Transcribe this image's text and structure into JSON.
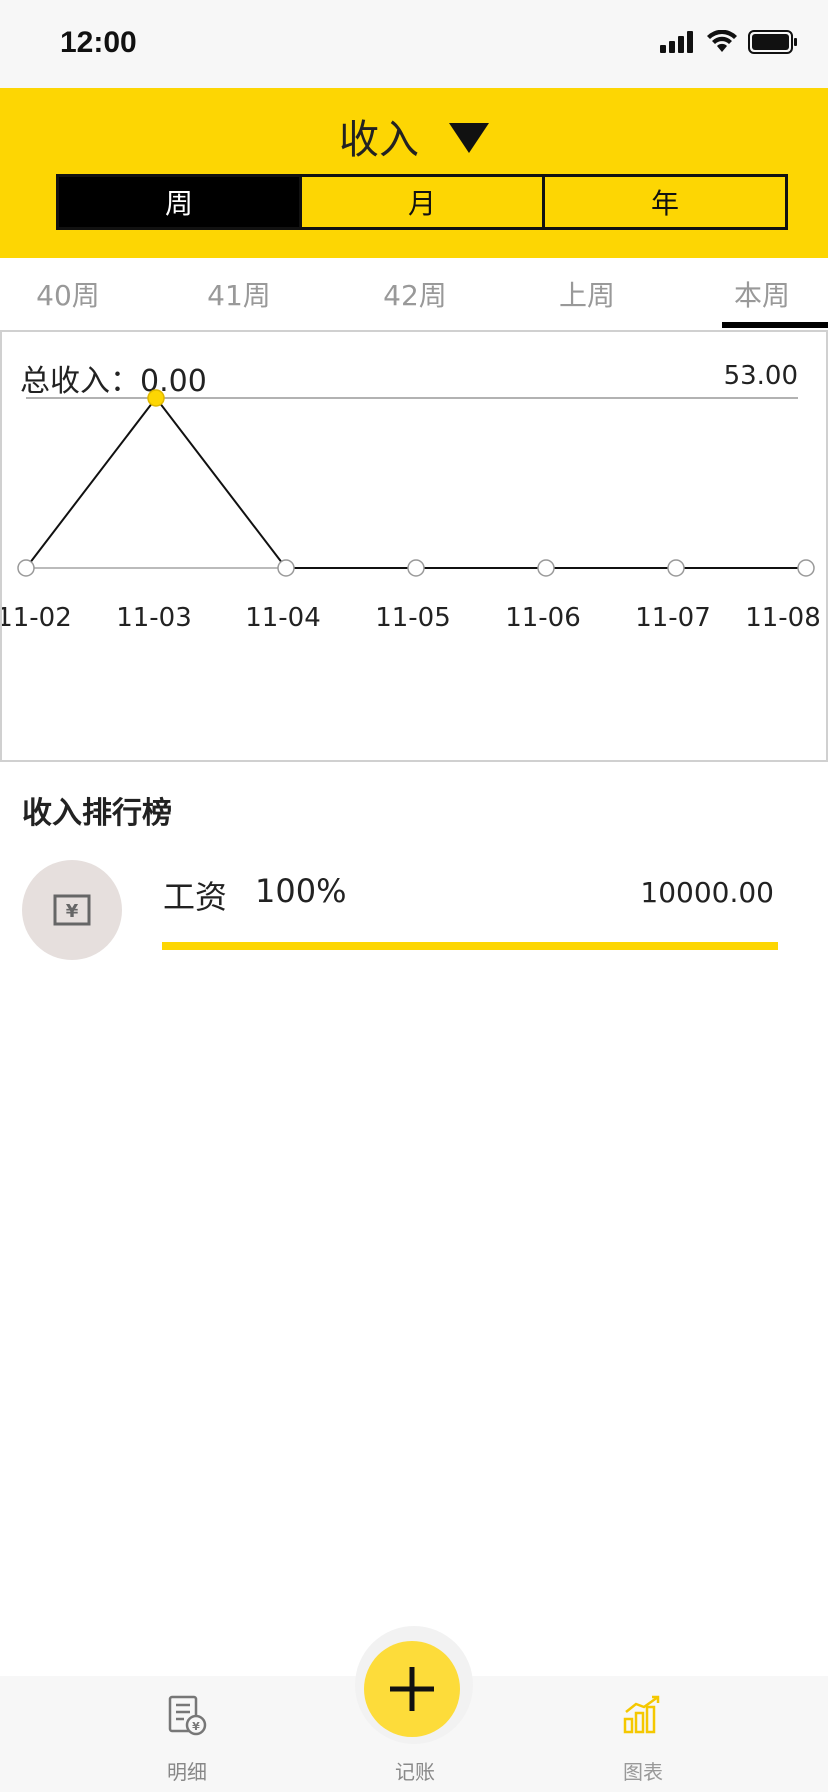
{
  "status_bar": {
    "time": "12:00"
  },
  "header": {
    "title": "收入",
    "segments": [
      {
        "label": "周",
        "active": true
      },
      {
        "label": "月",
        "active": false
      },
      {
        "label": "年",
        "active": false
      }
    ]
  },
  "week_tabs": [
    {
      "label": "40周",
      "active": false
    },
    {
      "label": "41周",
      "active": false
    },
    {
      "label": "42周",
      "active": false
    },
    {
      "label": "上周",
      "active": false
    },
    {
      "label": "本周",
      "active": true
    }
  ],
  "summary": {
    "total_label": "总收入：",
    "total_value": "0.00"
  },
  "chart_data": {
    "type": "line",
    "x": [
      "11-02",
      "11-03",
      "11-04",
      "11-05",
      "11-06",
      "11-07",
      "11-08"
    ],
    "series": [
      {
        "values": [
          0,
          53,
          0,
          0,
          0,
          0,
          0
        ]
      }
    ],
    "max_label": "53.00",
    "ylim": [
      0,
      53
    ],
    "highlight_index": 1,
    "highlight_color": "#fdd603",
    "line_color": "#111111",
    "grid": false
  },
  "ranking": {
    "title": "收入排行榜",
    "items": [
      {
        "icon": "yen-note-icon",
        "name": "工资",
        "percent": "100%",
        "amount": "10000.00",
        "ratio": 1.0
      }
    ]
  },
  "tabbar": {
    "items": [
      {
        "label": "明细",
        "icon": "bill-detail-icon",
        "active": false
      },
      {
        "label": "记账",
        "icon": "plus-icon",
        "active": false
      },
      {
        "label": "图表",
        "icon": "bar-chart-icon",
        "active": true
      }
    ]
  },
  "colors": {
    "accent": "#fdd603",
    "fab": "#fddc3a",
    "avatar_bg": "#e6dfdd"
  }
}
